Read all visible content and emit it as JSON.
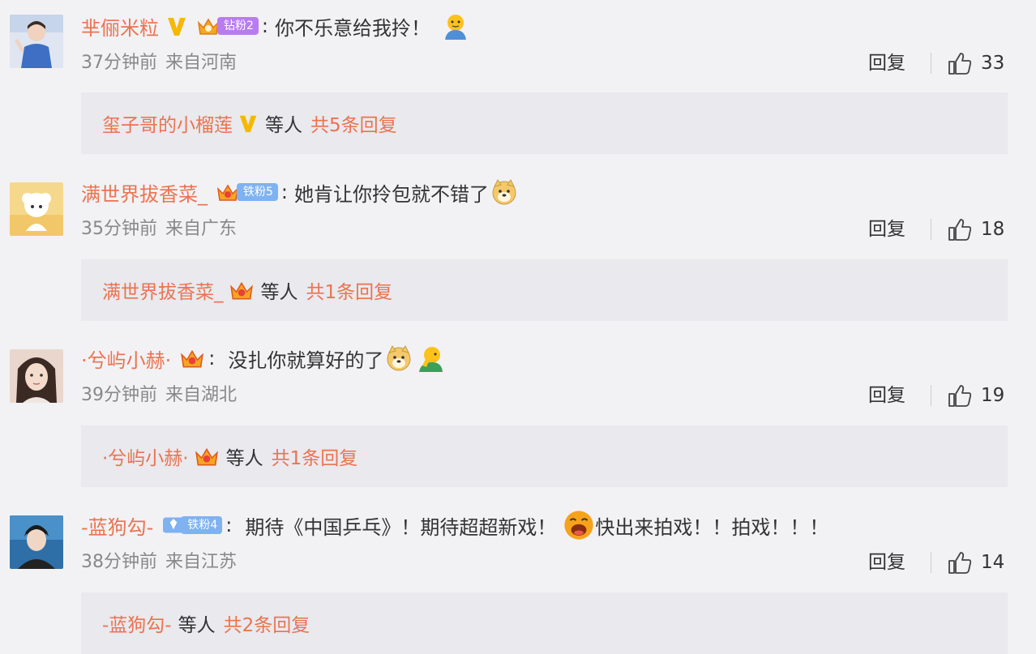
{
  "colors": {
    "username": "#eb7350",
    "text": "#333333",
    "meta": "#888888",
    "bg": "#f2f2f5",
    "replyBg": "#e9e9ee"
  },
  "comments": [
    {
      "username": "芈俪米粒",
      "fan_badge": "钻粉2",
      "text": "你不乐意给我拎！",
      "time": "37分钟前",
      "location": "来自河南",
      "reply_label": "回复",
      "likes": "33",
      "reply_user": "玺子哥的小榴莲",
      "reply_mid": "等人",
      "reply_count": "共5条回复"
    },
    {
      "username": "满世界拔香菜_",
      "fan_badge": "铁粉5",
      "text": "她肯让你拎包就不错了",
      "time": "35分钟前",
      "location": "来自广东",
      "reply_label": "回复",
      "likes": "18",
      "reply_user": "满世界拔香菜_",
      "reply_mid": "等人",
      "reply_count": "共1条回复"
    },
    {
      "username": "·兮屿小赫·",
      "fan_badge": "",
      "text": "没扎你就算好的了",
      "time": "39分钟前",
      "location": "来自湖北",
      "reply_label": "回复",
      "likes": "19",
      "reply_user": "·兮屿小赫·",
      "reply_mid": "等人",
      "reply_count": "共1条回复"
    },
    {
      "username": "-蓝狗勾-",
      "fan_badge": "铁粉4",
      "text": "期待《中国乒乓》！期待超超新戏！",
      "text2": "快出来拍戏！！拍戏！！！",
      "time": "38分钟前",
      "location": "来自江苏",
      "reply_label": "回复",
      "likes": "14",
      "reply_user": "-蓝狗勾-",
      "reply_mid": "等人",
      "reply_count": "共2条回复"
    }
  ]
}
